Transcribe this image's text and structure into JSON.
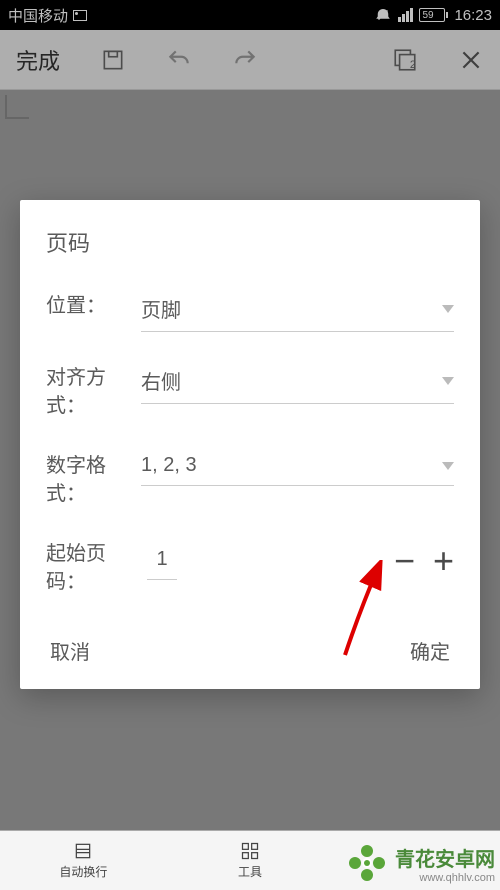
{
  "statusbar": {
    "carrier": "中国移动",
    "battery": "59",
    "time": "16:23"
  },
  "toolbar": {
    "done": "完成",
    "tab_count": "2"
  },
  "dialog": {
    "title": "页码",
    "position_label": "位置：",
    "position_value": "页脚",
    "align_label": "对齐方式：",
    "align_value": "右侧",
    "format_label": "数字格式：",
    "format_value": "1, 2, 3",
    "start_label": "起始页码：",
    "start_value": "1",
    "cancel": "取消",
    "ok": "确定"
  },
  "bottom_nav": {
    "item1": "自动换行",
    "item2": "工具"
  },
  "watermark": {
    "name": "青花安卓网",
    "url": "www.qhhlv.com"
  }
}
